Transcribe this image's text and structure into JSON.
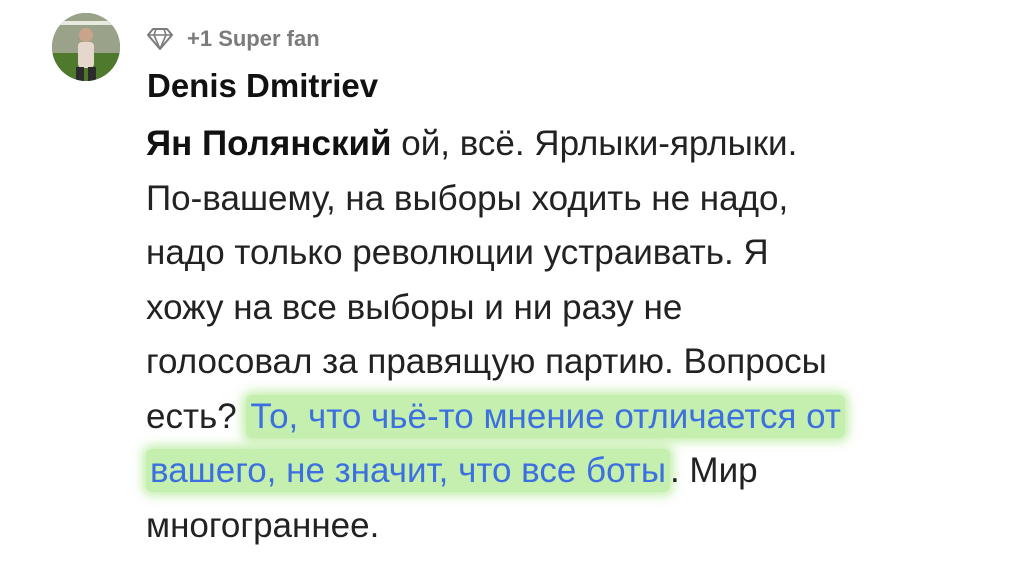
{
  "comment": {
    "badge": {
      "icon": "diamond-icon",
      "label": "+1 Super fan"
    },
    "author": "Denis Dmitriev",
    "mention": "Ян Полянский",
    "lines": [
      " ой, всё. Ярлыки-ярлыки.",
      "По-вашему, на выборы ходить не надо,",
      "надо только революции устраивать. Я",
      "хожу на все выборы и ни разу не",
      "голосовал за правящую партию. Вопросы"
    ],
    "line6_pre": "есть? ",
    "highlight_part1": "То, что чьё-то мнение отличается от",
    "highlight_part2": "вашего, не значит, что все боты",
    "line7_post": ". Мир",
    "line8": "многограннее.",
    "colors": {
      "highlight": "#96e16e",
      "highlight_text": "#3c6fe0",
      "badge_text": "#7b7b7b"
    }
  }
}
